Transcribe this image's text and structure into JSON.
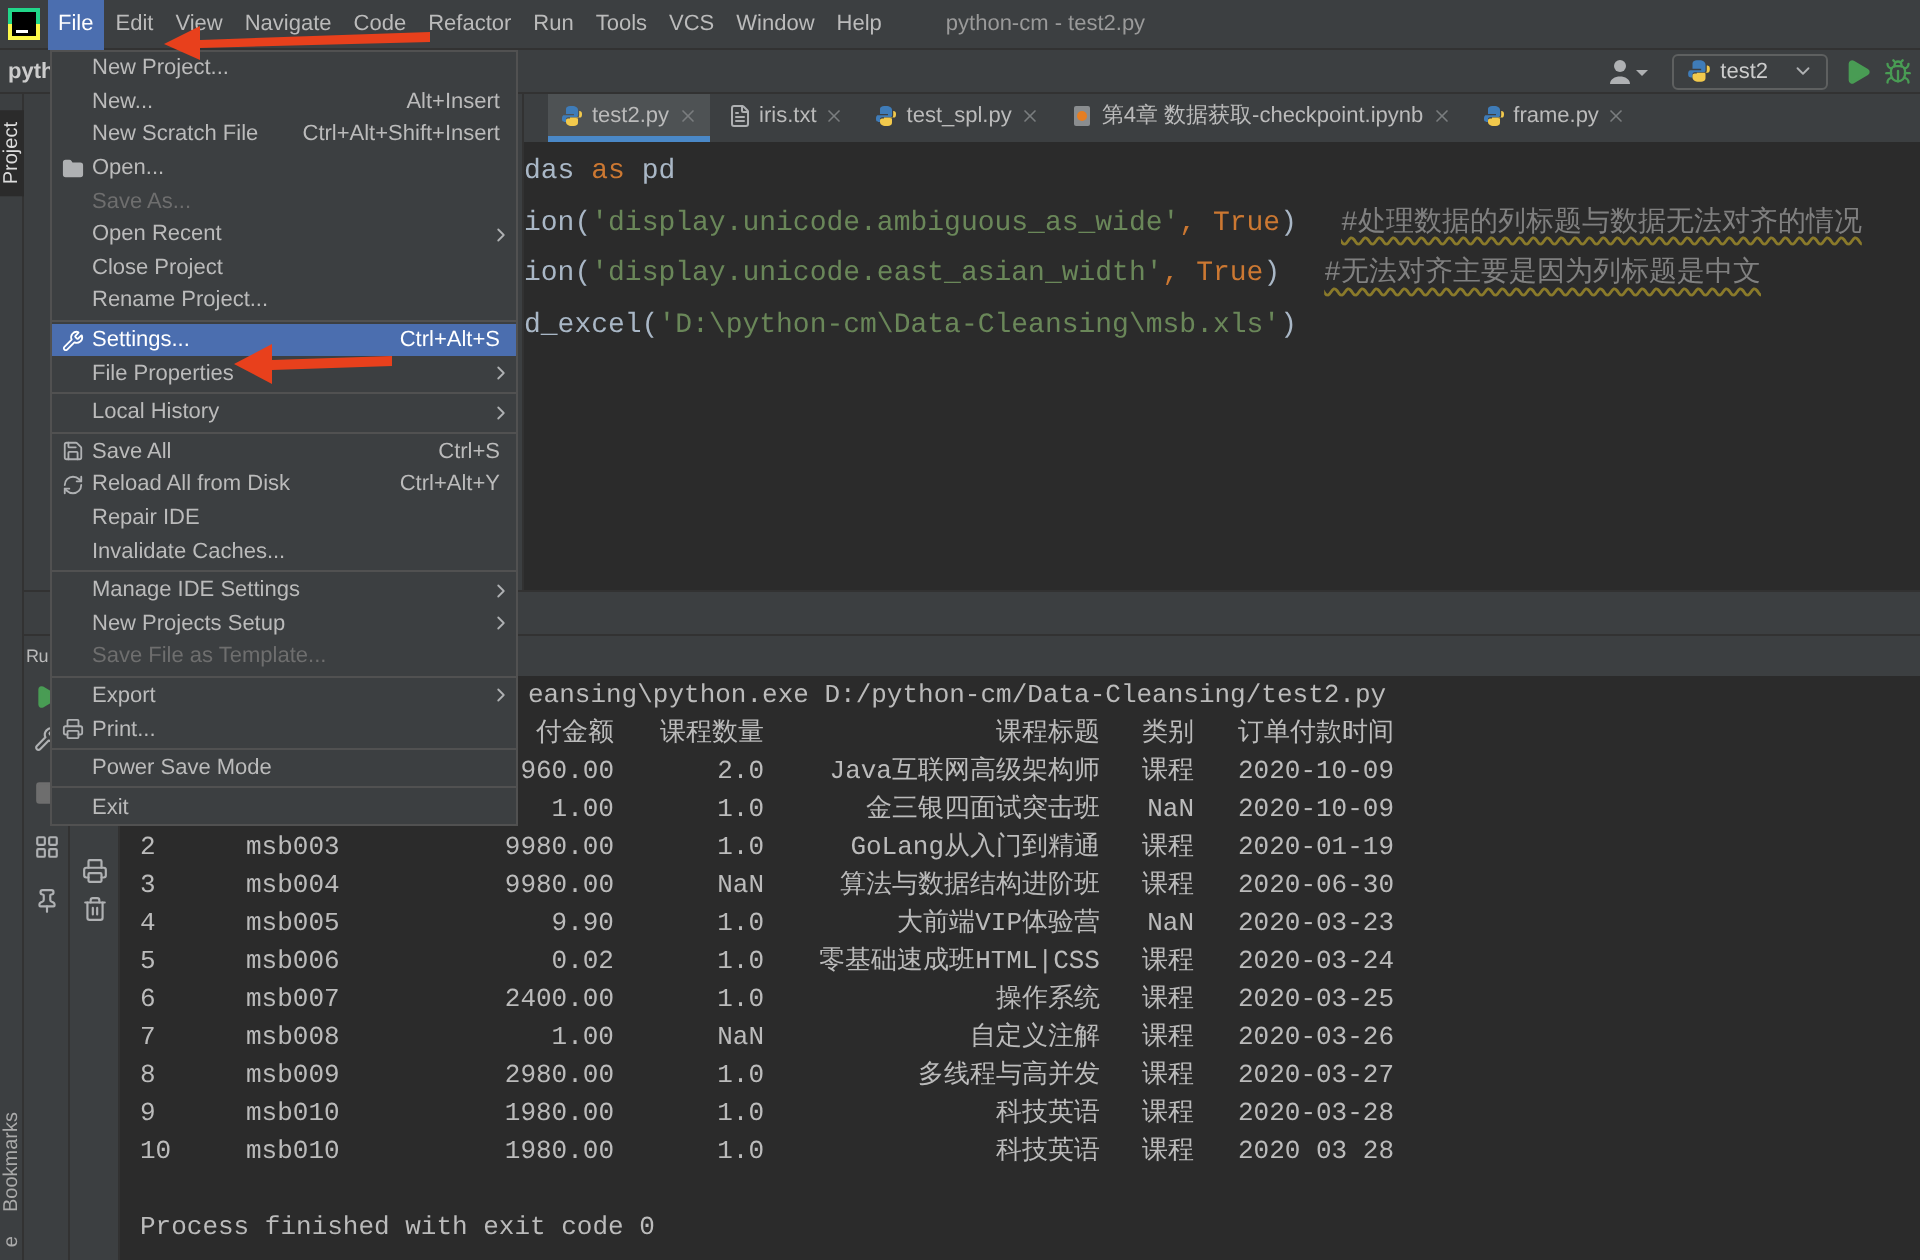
{
  "menu_bar": {
    "items": [
      {
        "label": "File",
        "selected": true
      },
      {
        "label": "Edit",
        "selected": false
      },
      {
        "label": "View",
        "selected": false
      },
      {
        "label": "Navigate",
        "selected": false
      },
      {
        "label": "Code",
        "selected": false
      },
      {
        "label": "Refactor",
        "selected": false
      },
      {
        "label": "Run",
        "selected": false
      },
      {
        "label": "Tools",
        "selected": false
      },
      {
        "label": "VCS",
        "selected": false
      },
      {
        "label": "Window",
        "selected": false
      },
      {
        "label": "Help",
        "selected": false
      }
    ],
    "title": "python-cm - test2.py"
  },
  "toolbar": {
    "project": "pyth",
    "run_config": "test2"
  },
  "tool_tabs": [
    {
      "label": "Project",
      "selected": true
    },
    {
      "label": "Bookmarks",
      "selected": false
    },
    {
      "label": "e",
      "selected": false
    }
  ],
  "editor": {
    "tabs": [
      {
        "label": "test2.py",
        "selected": true,
        "kind": "python"
      },
      {
        "label": "iris.txt",
        "selected": false,
        "kind": "text"
      },
      {
        "label": "test_spl.py",
        "selected": false,
        "kind": "python"
      },
      {
        "label": "第4章 数据获取-checkpoint.ipynb",
        "selected": false,
        "kind": "notebook"
      },
      {
        "label": "frame.py",
        "selected": false,
        "kind": "python"
      }
    ],
    "lines": [
      [
        {
          "kind": "plain",
          "text": "das "
        },
        {
          "kind": "keyword",
          "text": "as"
        },
        {
          "kind": "plain",
          "text": " pd"
        }
      ],
      [
        {
          "kind": "plain",
          "text": "ion("
        },
        {
          "kind": "string",
          "text": "'display.unicode.ambiguous_as_wide'"
        },
        {
          "kind": "keyword",
          "text": ", True"
        },
        {
          "kind": "plain",
          "text": ")"
        },
        {
          "kind": "comment",
          "text": "#处理数据的列标题与数据无法对齐的情况"
        }
      ],
      [
        {
          "kind": "plain",
          "text": "ion("
        },
        {
          "kind": "string",
          "text": "'display.unicode.east_asian_width'"
        },
        {
          "kind": "keyword",
          "text": ", True"
        },
        {
          "kind": "plain",
          "text": ")"
        },
        {
          "kind": "comment",
          "text": "#无法对齐主要是因为列标题是中文"
        }
      ],
      [
        {
          "kind": "plain",
          "text": "d_excel("
        },
        {
          "kind": "string",
          "text": "'D:\\python-cm\\Data-Cleansing\\msb.xls'"
        },
        {
          "kind": "plain",
          "text": ")"
        }
      ]
    ]
  },
  "run_window": {
    "title": "Ru",
    "console": {
      "command": "eansing\\python.exe D:/python-cm/Data-Cleansing/test2.py",
      "header": {
        "amount": "付金额",
        "quantity": "课程数量",
        "title": "课程标题",
        "category": "类别",
        "date": "订单付款时间"
      },
      "rows": [
        {
          "amount": "960.00",
          "quantity": "2.0",
          "title": "Java互联网高级架构师",
          "category": "课程",
          "date": "2020-10-09"
        },
        {
          "amount": "1.00",
          "quantity": "1.0",
          "title": "金三银四面试突击班",
          "category": "NaN",
          "date": "2020-10-09"
        },
        {
          "index": "2",
          "id": "msb003",
          "amount": "9980.00",
          "quantity": "1.0",
          "title": "GoLang从入门到精通",
          "category": "课程",
          "date": "2020-01-19"
        },
        {
          "index": "3",
          "id": "msb004",
          "amount": "9980.00",
          "quantity": "NaN",
          "title": "算法与数据结构进阶班",
          "category": "课程",
          "date": "2020-06-30"
        },
        {
          "index": "4",
          "id": "msb005",
          "amount": "9.90",
          "quantity": "1.0",
          "title": "大前端VIP体验营",
          "category": "NaN",
          "date": "2020-03-23"
        },
        {
          "index": "5",
          "id": "msb006",
          "amount": "0.02",
          "quantity": "1.0",
          "title": "零基础速成班HTML|CSS",
          "category": "课程",
          "date": "2020-03-24"
        },
        {
          "index": "6",
          "id": "msb007",
          "amount": "2400.00",
          "quantity": "1.0",
          "title": "操作系统",
          "category": "课程",
          "date": "2020-03-25"
        },
        {
          "index": "7",
          "id": "msb008",
          "amount": "1.00",
          "quantity": "NaN",
          "title": "自定义注解",
          "category": "课程",
          "date": "2020-03-26"
        },
        {
          "index": "8",
          "id": "msb009",
          "amount": "2980.00",
          "quantity": "1.0",
          "title": "多线程与高并发",
          "category": "课程",
          "date": "2020-03-27"
        },
        {
          "index": "9",
          "id": "msb010",
          "amount": "1980.00",
          "quantity": "1.0",
          "title": "科技英语",
          "category": "课程",
          "date": "2020-03-28"
        },
        {
          "index": "10",
          "id": "msb010",
          "amount": "1980.00",
          "quantity": "1.0",
          "title": "科技英语",
          "category": "课程",
          "date": "2020 03 28"
        }
      ],
      "footer": "Process finished with exit code 0"
    }
  },
  "file_menu": {
    "items": [
      {
        "kind": "item",
        "label": "New Project...",
        "selected": false,
        "disabled": false,
        "submenu": false
      },
      {
        "kind": "item",
        "label": "New...",
        "shortcut": "Alt+Insert",
        "selected": false,
        "disabled": false,
        "submenu": false
      },
      {
        "kind": "item",
        "label": "New Scratch File",
        "shortcut": "Ctrl+Alt+Shift+Insert",
        "selected": false,
        "disabled": false,
        "submenu": false
      },
      {
        "kind": "item",
        "label": "Open...",
        "selected": false,
        "disabled": false,
        "submenu": false
      },
      {
        "kind": "item",
        "label": "Save As...",
        "selected": false,
        "disabled": true,
        "submenu": false
      },
      {
        "kind": "item",
        "label": "Open Recent",
        "selected": false,
        "disabled": false,
        "submenu": true
      },
      {
        "kind": "item",
        "label": "Close Project",
        "selected": false,
        "disabled": false,
        "submenu": false
      },
      {
        "kind": "item",
        "label": "Rename Project...",
        "selected": false,
        "disabled": false,
        "submenu": false
      },
      {
        "kind": "separator"
      },
      {
        "kind": "item",
        "label": "Settings...",
        "shortcut": "Ctrl+Alt+S",
        "selected": true,
        "disabled": false,
        "submenu": false
      },
      {
        "kind": "item",
        "label": "File Properties",
        "selected": false,
        "disabled": false,
        "submenu": true
      },
      {
        "kind": "separator"
      },
      {
        "kind": "item",
        "label": "Local History",
        "selected": false,
        "disabled": false,
        "submenu": true
      },
      {
        "kind": "separator"
      },
      {
        "kind": "item",
        "label": "Save All",
        "shortcut": "Ctrl+S",
        "selected": false,
        "disabled": false,
        "submenu": false
      },
      {
        "kind": "item",
        "label": "Reload All from Disk",
        "shortcut": "Ctrl+Alt+Y",
        "selected": false,
        "disabled": false,
        "submenu": false
      },
      {
        "kind": "item",
        "label": "Repair IDE",
        "selected": false,
        "disabled": false,
        "submenu": false
      },
      {
        "kind": "item",
        "label": "Invalidate Caches...",
        "selected": false,
        "disabled": false,
        "submenu": false
      },
      {
        "kind": "separator"
      },
      {
        "kind": "item",
        "label": "Manage IDE Settings",
        "selected": false,
        "disabled": false,
        "submenu": true
      },
      {
        "kind": "item",
        "label": "New Projects Setup",
        "selected": false,
        "disabled": false,
        "submenu": true
      },
      {
        "kind": "item",
        "label": "Save File as Template...",
        "selected": false,
        "disabled": true,
        "submenu": false
      },
      {
        "kind": "separator"
      },
      {
        "kind": "item",
        "label": "Export",
        "selected": false,
        "disabled": false,
        "submenu": true
      },
      {
        "kind": "item",
        "label": "Print...",
        "selected": false,
        "disabled": false,
        "submenu": false
      },
      {
        "kind": "separator"
      },
      {
        "kind": "item",
        "label": "Power Save Mode",
        "selected": false,
        "disabled": false,
        "submenu": false
      },
      {
        "kind": "separator"
      },
      {
        "kind": "item",
        "label": "Exit",
        "selected": false,
        "disabled": false,
        "submenu": false
      }
    ]
  }
}
